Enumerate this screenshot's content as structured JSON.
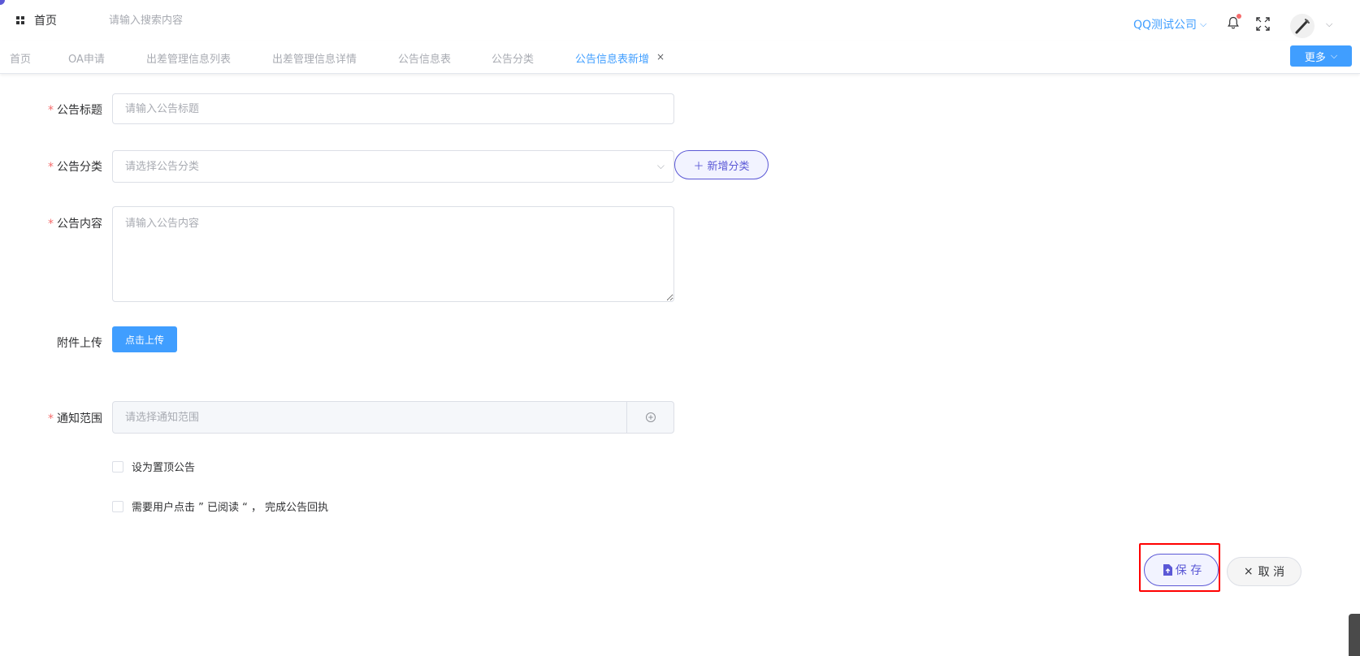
{
  "header": {
    "home_label": "首页",
    "search_placeholder": "请输入搜索内容",
    "company": "QQ测试公司"
  },
  "tabs": [
    {
      "label": "首页",
      "active": false
    },
    {
      "label": "OA申请",
      "active": false
    },
    {
      "label": "出差管理信息列表",
      "active": false
    },
    {
      "label": "出差管理信息详情",
      "active": false
    },
    {
      "label": "公告信息表",
      "active": false
    },
    {
      "label": "公告分类",
      "active": false
    },
    {
      "label": "公告信息表新增",
      "active": true
    }
  ],
  "more_button": "更多",
  "form": {
    "title": {
      "label": "公告标题",
      "placeholder": "请输入公告标题"
    },
    "category": {
      "label": "公告分类",
      "placeholder": "请选择公告分类",
      "add_button": "新增分类"
    },
    "content": {
      "label": "公告内容",
      "placeholder": "请输入公告内容"
    },
    "attachment": {
      "label": "附件上传",
      "button": "点击上传"
    },
    "scope": {
      "label": "通知范围",
      "placeholder": "请选择通知范围"
    },
    "pin_checkbox": "设为置顶公告",
    "receipt_checkbox": "需要用户点击 ” 已阅读 “ ， 完成公告回执"
  },
  "actions": {
    "save": "保 存",
    "cancel": "取 消"
  },
  "colors": {
    "primary": "#409eff",
    "accent": "#5b58d6",
    "required": "#f56c6c",
    "highlight": "#ff0000"
  }
}
